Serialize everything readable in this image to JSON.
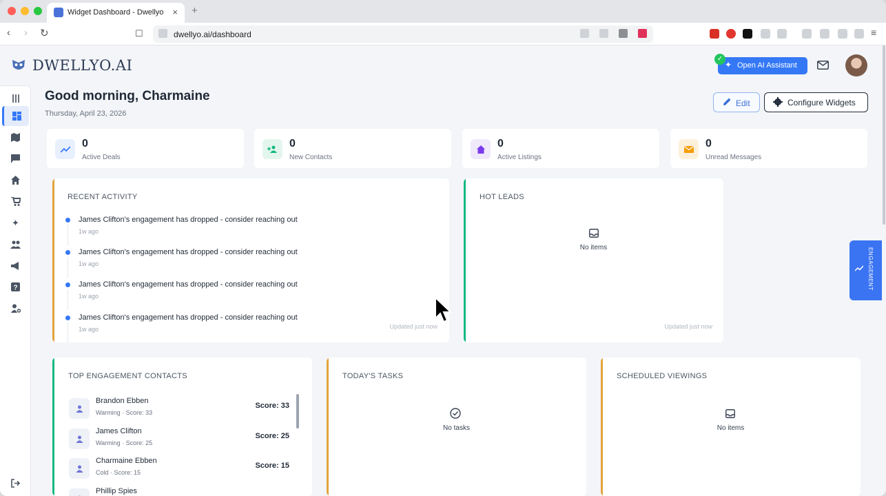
{
  "browser": {
    "tab_title": "Widget Dashboard - Dwellyo",
    "url": "dwellyo.ai/dashboard"
  },
  "header": {
    "brand": "DWELLYO.AI",
    "ai_button": "Open AI Assistant"
  },
  "greeting": {
    "title": "Good morning, Charmaine",
    "date": "Thursday, April 23, 2026",
    "edit_label": "Edit",
    "configure_label": "Configure Widgets"
  },
  "stats": [
    {
      "value": "0",
      "label": "Active Deals",
      "icon": "trend-up-icon",
      "color": "#3478f6"
    },
    {
      "value": "0",
      "label": "New Contacts",
      "icon": "add-contact-icon",
      "color": "#10b981"
    },
    {
      "value": "0",
      "label": "Active Listings",
      "icon": "home-icon",
      "color": "#7c3aed"
    },
    {
      "value": "0",
      "label": "Unread Messages",
      "icon": "envelope-icon",
      "color": "#f59e0b"
    }
  ],
  "recent_activity": {
    "title": "RECENT ACTIVITY",
    "items": [
      {
        "text": "James Clifton's engagement has dropped - consider reaching out",
        "time": "1w ago"
      },
      {
        "text": "James Clifton's engagement has dropped - consider reaching out",
        "time": "1w ago"
      },
      {
        "text": "James Clifton's engagement has dropped - consider reaching out",
        "time": "1w ago"
      },
      {
        "text": "James Clifton's engagement has dropped - consider reaching out",
        "time": "1w ago"
      }
    ],
    "updated": "Updated just now"
  },
  "hot_leads": {
    "title": "HOT LEADS",
    "empty": "No items",
    "updated": "Updated just now"
  },
  "top_contacts": {
    "title": "TOP ENGAGEMENT CONTACTS",
    "items": [
      {
        "name": "Brandon Ebben",
        "sub": "Warming · Score: 33",
        "score": "Score: 33"
      },
      {
        "name": "James Clifton",
        "sub": "Warming · Score: 25",
        "score": "Score: 25"
      },
      {
        "name": "Charmaine Ebben",
        "sub": "Cold · Score: 15",
        "score": "Score: 15"
      },
      {
        "name": "Phillip Spies",
        "sub": "",
        "score": ""
      }
    ]
  },
  "tasks": {
    "title": "TODAY'S TASKS",
    "empty": "No tasks"
  },
  "viewings": {
    "title": "SCHEDULED VIEWINGS",
    "empty": "No items"
  },
  "engagement_tab": "ENGAGEMENT",
  "colors": {
    "accent": "#3478f6",
    "activity_bar": "#e3a33b",
    "hot_leads_bar": "#10b981",
    "contacts_bar": "#10b981",
    "tasks_bar": "#e3a33b",
    "viewings_bar": "#e3a33b"
  }
}
